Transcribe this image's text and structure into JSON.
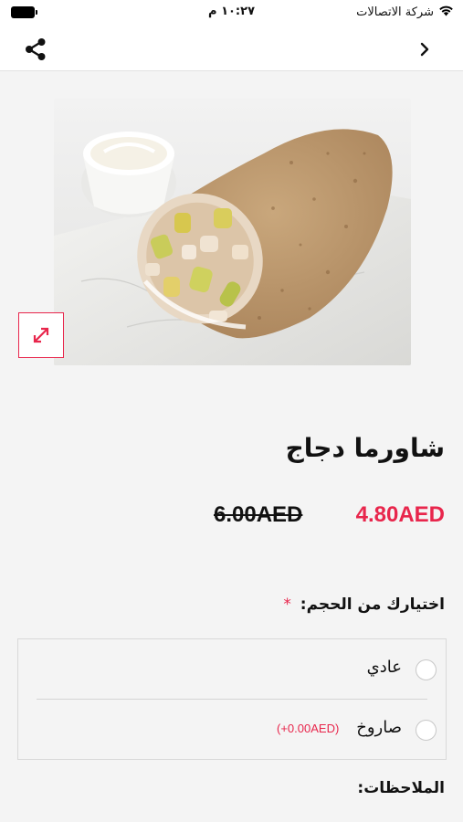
{
  "status_bar": {
    "carrier": "شركة الاتصالات",
    "time": "١٠:٢٧ م"
  },
  "nav": {
    "share_icon": "share-icon",
    "back_icon": "chevron-right-icon"
  },
  "product": {
    "name": "شاورما دجاج",
    "price_new": "4.80AED",
    "price_old": "6.00AED",
    "expand_icon": "expand-icon"
  },
  "size": {
    "label": "اختيارك من الحجم:",
    "required_mark": "*",
    "options": [
      {
        "label": "عادي",
        "extra": ""
      },
      {
        "label": "صاروخ",
        "extra": "(+0.00AED)"
      }
    ]
  },
  "notes": {
    "label": "الملاحظات:"
  },
  "colors": {
    "accent": "#e8264c",
    "background": "#f4f4f4"
  }
}
